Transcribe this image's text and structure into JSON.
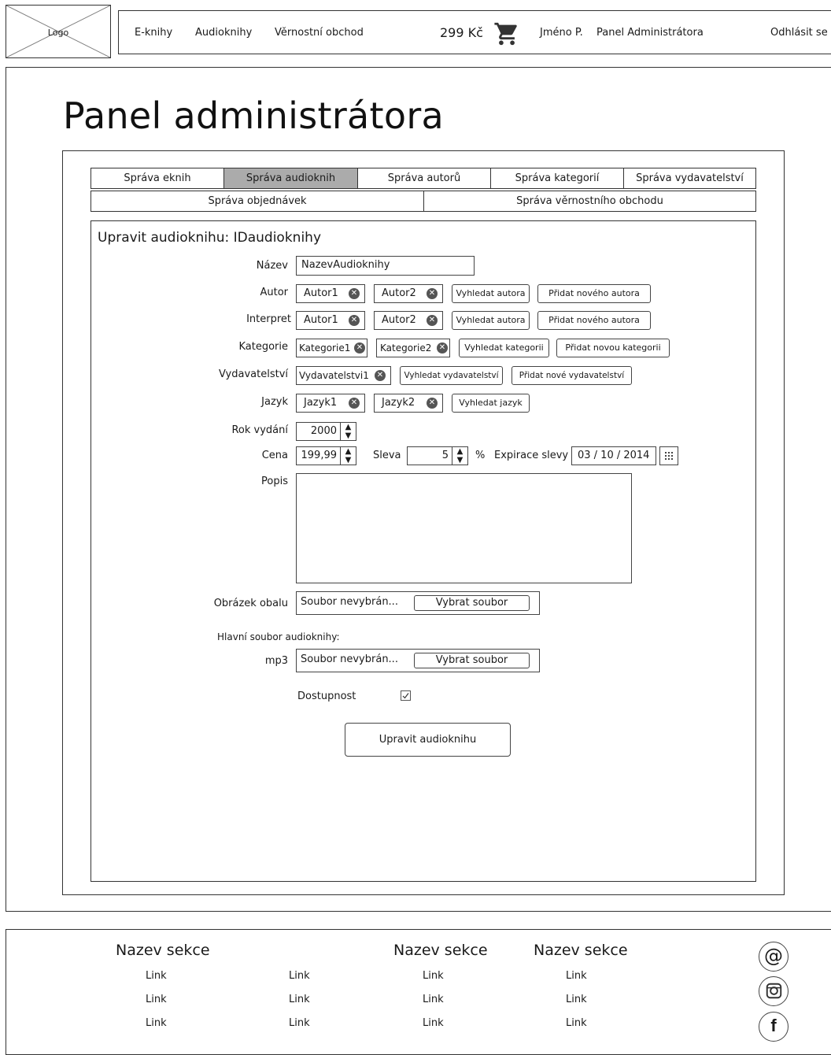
{
  "header": {
    "logo": "Logo",
    "nav": [
      "E-knihy",
      "Audioknihy",
      "Věrnostní obchod"
    ],
    "cart_price": "299 Kč",
    "user": "Jméno P.",
    "admin": "Panel Administrátora",
    "logout": "Odhlásit se"
  },
  "page": {
    "title": "Panel administrátora"
  },
  "tabs_row1": [
    "Správa eknih",
    "Správa audioknih",
    "Správa autorů",
    "Správa kategorií",
    "Správa vydavatelství"
  ],
  "tabs_row2": [
    "Správa objednávek",
    "Správa věrnostního obchodu"
  ],
  "form": {
    "title": "Upravit audioknihu: IDaudioknihy",
    "name_label": "Název",
    "name_value": "NazevAudioknihy",
    "author_label": "Autor",
    "authors": [
      "Autor1",
      "Autor2"
    ],
    "search_author": "Vyhledat autora",
    "add_author": "Přidat nového autora",
    "interpret_label": "Interpret",
    "interprets": [
      "Autor1",
      "Autor2"
    ],
    "category_label": "Kategorie",
    "categories": [
      "Kategorie1",
      "Kategorie2"
    ],
    "search_category": "Vyhledat kategorii",
    "add_category": "Přidat novou kategorii",
    "publisher_label": "Vydavatelství",
    "publishers": [
      "Vydavatelstvi1"
    ],
    "search_publisher": "Vyhledat vydavatelství",
    "add_publisher": "Přidat nové vydavatelství",
    "language_label": "Jazyk",
    "languages": [
      "Jazyk1",
      "Jazyk2"
    ],
    "search_language": "Vyhledat jazyk",
    "year_label": "Rok vydání",
    "year_value": "2000",
    "price_label": "Cena",
    "price_value": "199,99",
    "discount_label": "Sleva",
    "discount_value": "5",
    "percent": "%",
    "discount_exp_label": "Expirace slevy",
    "discount_exp_value": "03 / 10 / 2014",
    "description_label": "Popis",
    "description_value": "",
    "cover_label": "Obrázek obalu",
    "no_file": "Soubor nevybrán...",
    "choose_file": "Vybrat soubor",
    "main_file_label": "Hlavní soubor audioknihy:",
    "mp3_label": "mp3",
    "availability_label": "Dostupnost",
    "availability_checked": true,
    "submit": "Upravit audioknihu"
  },
  "footer": {
    "sections": [
      "Nazev sekce",
      "Nazev sekce",
      "Nazev sekce"
    ],
    "link": "Link",
    "social_icons": [
      "at-icon",
      "instagram-icon",
      "facebook-icon"
    ]
  }
}
